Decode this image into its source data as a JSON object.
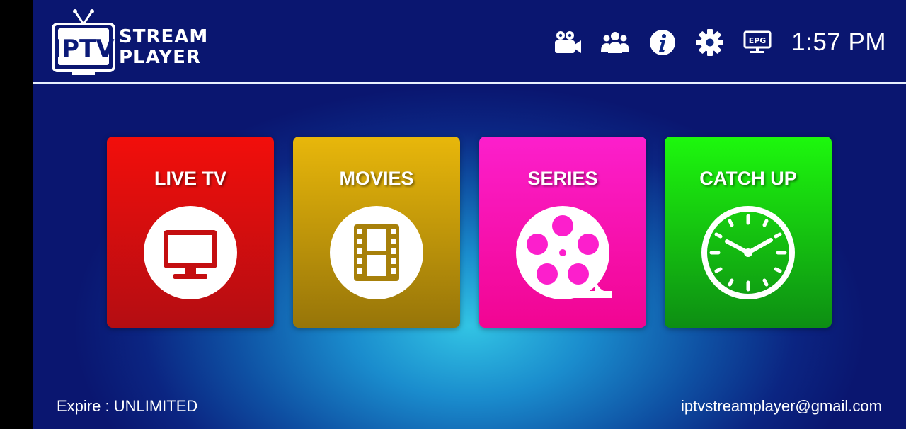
{
  "header": {
    "logo": {
      "badge": "IPTV",
      "line1": "STREAM",
      "line2": "PLAYER"
    },
    "icons": [
      "video-camera-icon",
      "users-icon",
      "info-icon",
      "settings-icon",
      "epg-icon"
    ],
    "epg_label": "EPG",
    "time": "1:57 PM"
  },
  "tiles": [
    {
      "label": "LIVE TV",
      "icon": "tv-icon",
      "color": "#f20e0b"
    },
    {
      "label": "MOVIES",
      "icon": "film-strip-icon",
      "color": "#e8b70b"
    },
    {
      "label": "SERIES",
      "icon": "film-reel-icon",
      "color": "#fc1fcc"
    },
    {
      "label": "CATCH UP",
      "icon": "clock-icon",
      "color": "#1df80d"
    }
  ],
  "footer": {
    "expire": "Expire : UNLIMITED",
    "email": "iptvstreamplayer@gmail.com"
  }
}
